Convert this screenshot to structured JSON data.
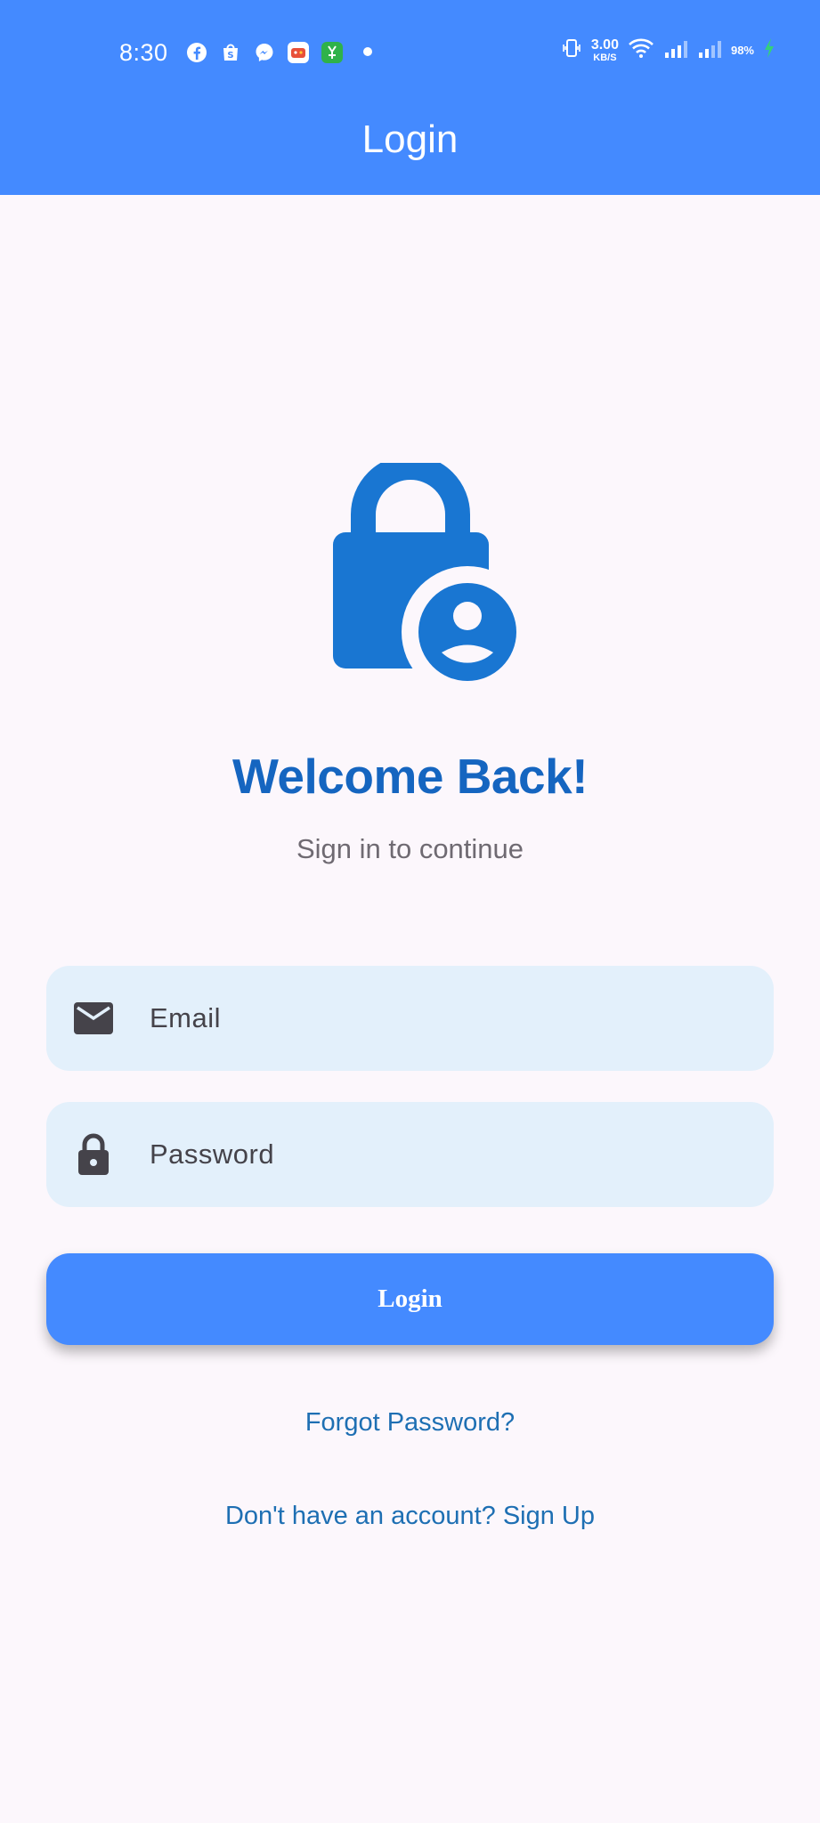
{
  "status_bar": {
    "time": "8:30",
    "net_speed_value": "3.00",
    "net_speed_unit": "KB/S",
    "battery": "98%",
    "notification_icons": [
      "facebook-icon",
      "shopping-bag-icon",
      "messenger-icon",
      "game-icon",
      "app-store-icon"
    ],
    "system_icons": [
      "vibrate-icon",
      "wifi-icon",
      "signal-icon",
      "signal-icon",
      "charging-icon"
    ]
  },
  "app_bar": {
    "title": "Login"
  },
  "hero": {
    "icon": "lock-person-icon",
    "title": "Welcome Back!",
    "subtitle": "Sign in to continue"
  },
  "form": {
    "email": {
      "icon": "mail-icon",
      "placeholder": "Email",
      "value": ""
    },
    "password": {
      "icon": "lock-icon",
      "placeholder": "Password",
      "value": ""
    },
    "login_label": "Login"
  },
  "links": {
    "forgot_password": "Forgot Password?",
    "signup": "Don't have an account? Sign Up"
  },
  "colors": {
    "primary": "#448aff",
    "heading": "#1565c0",
    "icon_blue": "#1976d2",
    "field_bg": "#e3f0fb",
    "background": "#fcf7fc",
    "link": "#1e6fb3"
  }
}
